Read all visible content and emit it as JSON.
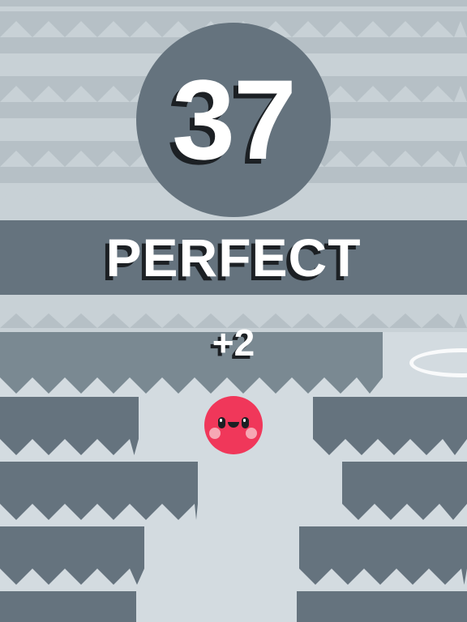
{
  "game": {
    "score": "37",
    "rating": "PERFECT",
    "bonus": "+2"
  },
  "colors": {
    "background": "#d3dbe0",
    "background_wall": "#b6c0c6",
    "background_spike": "#c8d1d6",
    "wall": "#65737e",
    "wall_light": "#7a8992",
    "player": "#f0375a",
    "text": "#ffffff",
    "text_shadow": "#1c2024"
  }
}
